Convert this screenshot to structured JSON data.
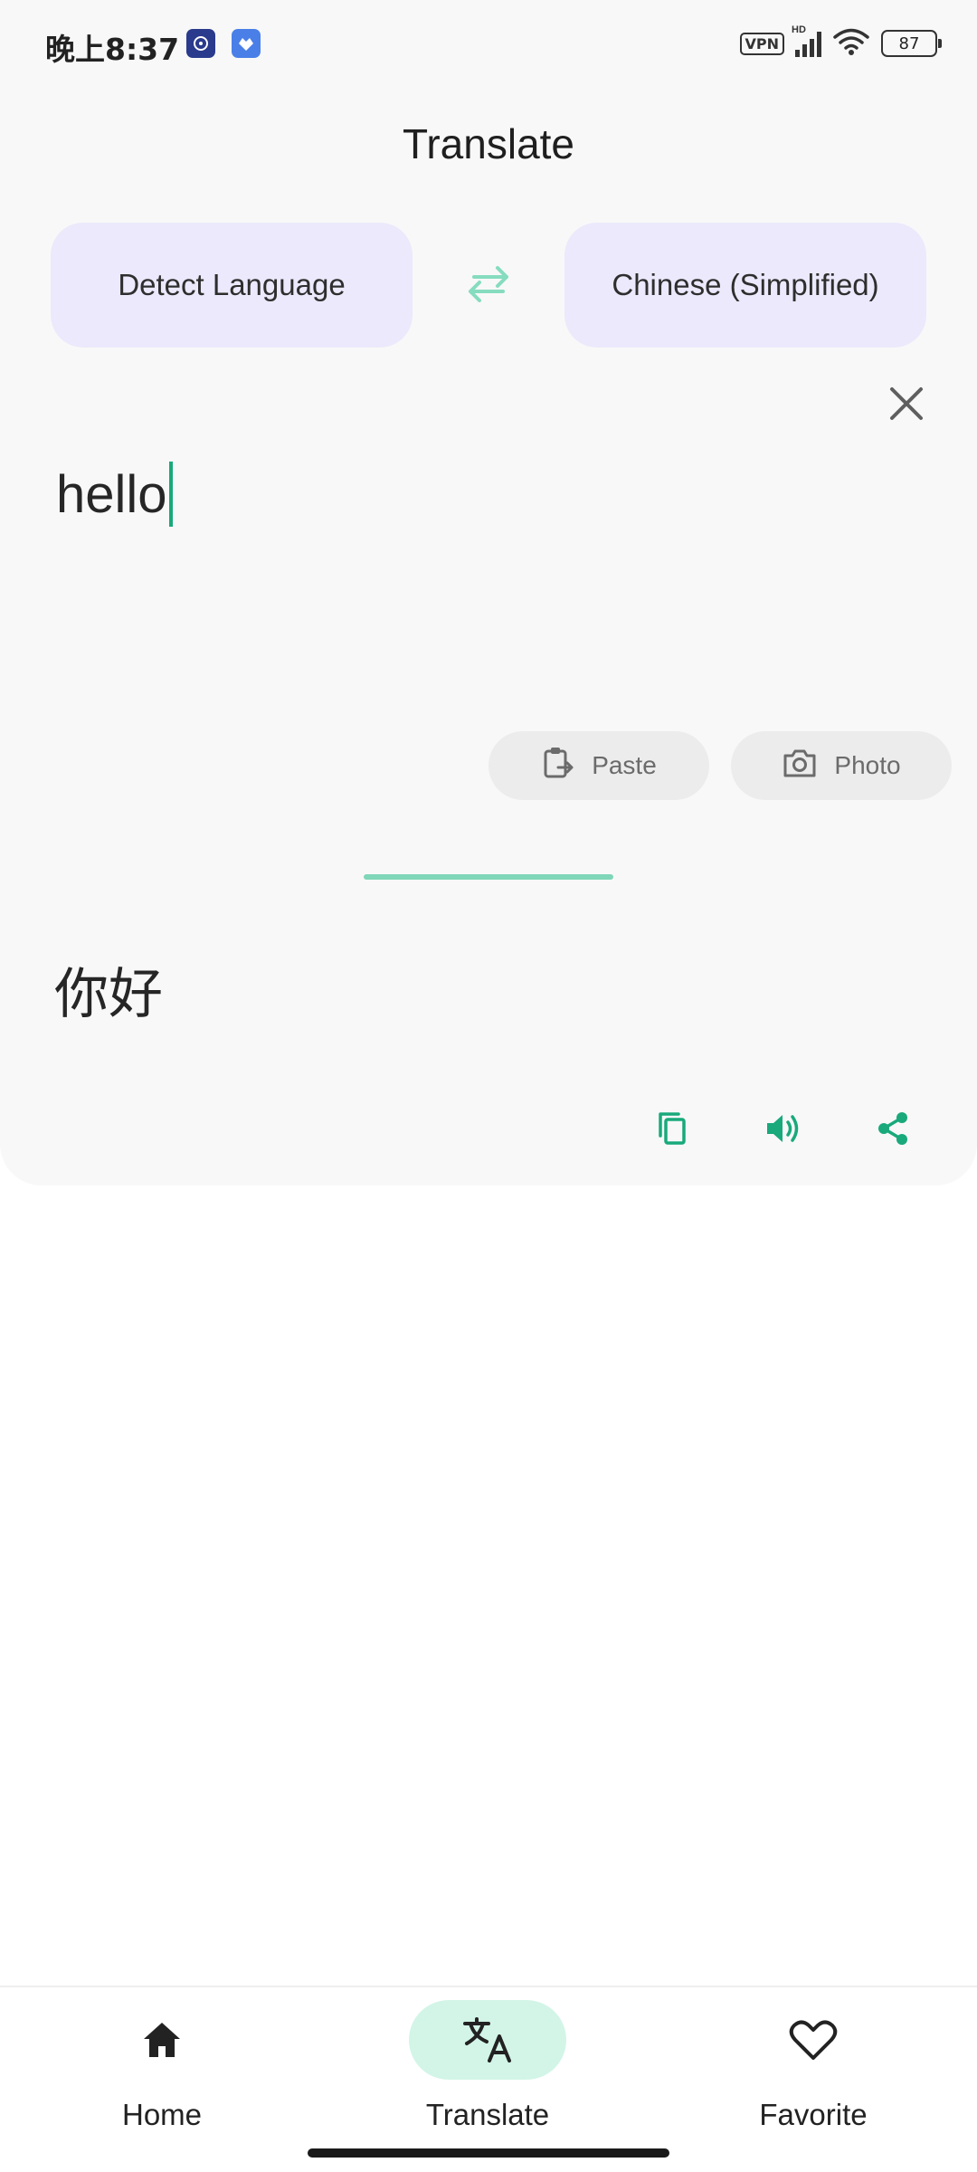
{
  "status_bar": {
    "time": "晚上8:37",
    "vpn": "VPN",
    "hd": "HD",
    "battery": "87"
  },
  "header": {
    "title": "Translate"
  },
  "languages": {
    "source": "Detect Language",
    "target": "Chinese (Simplified)"
  },
  "input": {
    "text": "hello"
  },
  "chips": {
    "paste": "Paste",
    "photo": "Photo"
  },
  "output": {
    "text": "你好"
  },
  "colors": {
    "accent": "#19a97b",
    "lang_bg": "#ebe9fb",
    "nav_active_bg": "#d2f5e7"
  },
  "bottom_nav": {
    "home": "Home",
    "translate": "Translate",
    "favorite": "Favorite"
  }
}
